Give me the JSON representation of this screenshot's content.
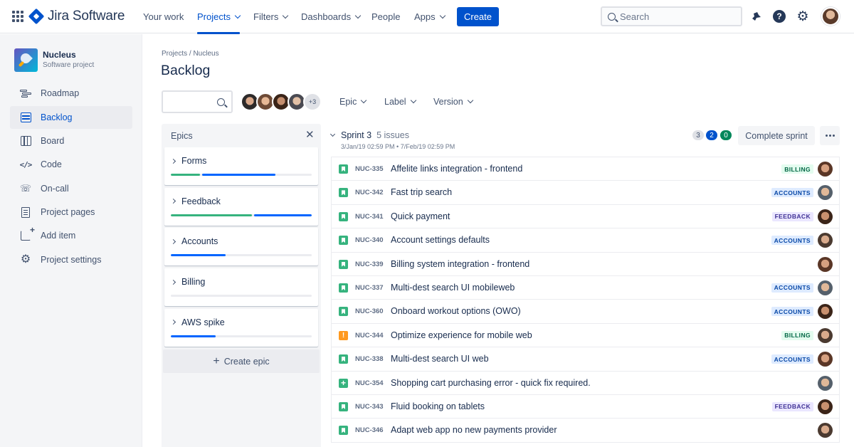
{
  "app": {
    "title": "Jira Software"
  },
  "nav": {
    "items": [
      "Your work",
      "Projects",
      "Filters",
      "Dashboards",
      "People",
      "Apps"
    ],
    "create": "Create",
    "search_placeholder": "Search"
  },
  "sidebar": {
    "project_name": "Nucleus",
    "project_type": "Software project",
    "items": [
      {
        "label": "Roadmap",
        "icon": "roadmap-icon"
      },
      {
        "label": "Backlog",
        "icon": "backlog-icon"
      },
      {
        "label": "Board",
        "icon": "board-icon"
      },
      {
        "label": "Code",
        "icon": "code-icon"
      },
      {
        "label": "On-call",
        "icon": "on-call-icon"
      },
      {
        "label": "Project pages",
        "icon": "page-icon"
      },
      {
        "label": "Add item",
        "icon": "add-item-icon"
      },
      {
        "label": "Project settings",
        "icon": "gear-icon"
      }
    ]
  },
  "main": {
    "breadcrumb": "Projects / Nucleus",
    "title": "Backlog",
    "avatars_more": "+3",
    "filters": [
      "Epic",
      "Label",
      "Version"
    ]
  },
  "epics": {
    "header": "Epics",
    "items": [
      {
        "name": "Forms",
        "done": 0.22,
        "in_progress": 0.52
      },
      {
        "name": "Feedback",
        "done": 0.59,
        "in_progress": 0.41
      },
      {
        "name": "Accounts",
        "done": 0.0,
        "in_progress": 0.39
      },
      {
        "name": "Billing",
        "done": 0.0,
        "in_progress": 0.0
      },
      {
        "name": "AWS spike",
        "done": 0.0,
        "in_progress": 0.32
      }
    ],
    "create_label": "Create epic"
  },
  "sprint": {
    "name": "Sprint 3",
    "issue_count": "5 issues",
    "dates": "3/Jan/19 02:59 PM • 7/Feb/19 02:59 PM",
    "counts": [
      "3",
      "2",
      "0"
    ],
    "complete_label": "Complete sprint"
  },
  "issues": [
    {
      "type": "story",
      "key": "NUC-335",
      "summary": "Affelite links integration - frontend",
      "label": "BILLING",
      "label_color": "green"
    },
    {
      "type": "story",
      "key": "NUC-342",
      "summary": "Fast trip search",
      "label": "ACCOUNTS",
      "label_color": "blue"
    },
    {
      "type": "story",
      "key": "NUC-341",
      "summary": "Quick payment",
      "label": "FEEDBACK",
      "label_color": "purple"
    },
    {
      "type": "story",
      "key": "NUC-340",
      "summary": "Account settings defaults",
      "label": "ACCOUNTS",
      "label_color": "blue"
    },
    {
      "type": "story",
      "key": "NUC-339",
      "summary": "Billing system integration - frontend",
      "label": "",
      "label_color": ""
    },
    {
      "type": "story",
      "key": "NUC-337",
      "summary": "Multi-dest search UI mobileweb",
      "label": "ACCOUNTS",
      "label_color": "blue"
    },
    {
      "type": "story",
      "key": "NUC-360",
      "summary": "Onboard workout options (OWO)",
      "label": "ACCOUNTS",
      "label_color": "blue"
    },
    {
      "type": "bug",
      "key": "NUC-344",
      "summary": "Optimize experience for mobile web",
      "label": "BILLING",
      "label_color": "green"
    },
    {
      "type": "story",
      "key": "NUC-338",
      "summary": "Multi-dest search UI web",
      "label": "ACCOUNTS",
      "label_color": "blue"
    },
    {
      "type": "add",
      "key": "NUC-354",
      "summary": "Shopping cart purchasing error - quick fix required.",
      "label": "",
      "label_color": ""
    },
    {
      "type": "story",
      "key": "NUC-343",
      "summary": "Fluid booking on tablets",
      "label": "FEEDBACK",
      "label_color": "purple"
    },
    {
      "type": "story",
      "key": "NUC-346",
      "summary": "Adapt web app no new payments provider",
      "label": "",
      "label_color": ""
    }
  ]
}
